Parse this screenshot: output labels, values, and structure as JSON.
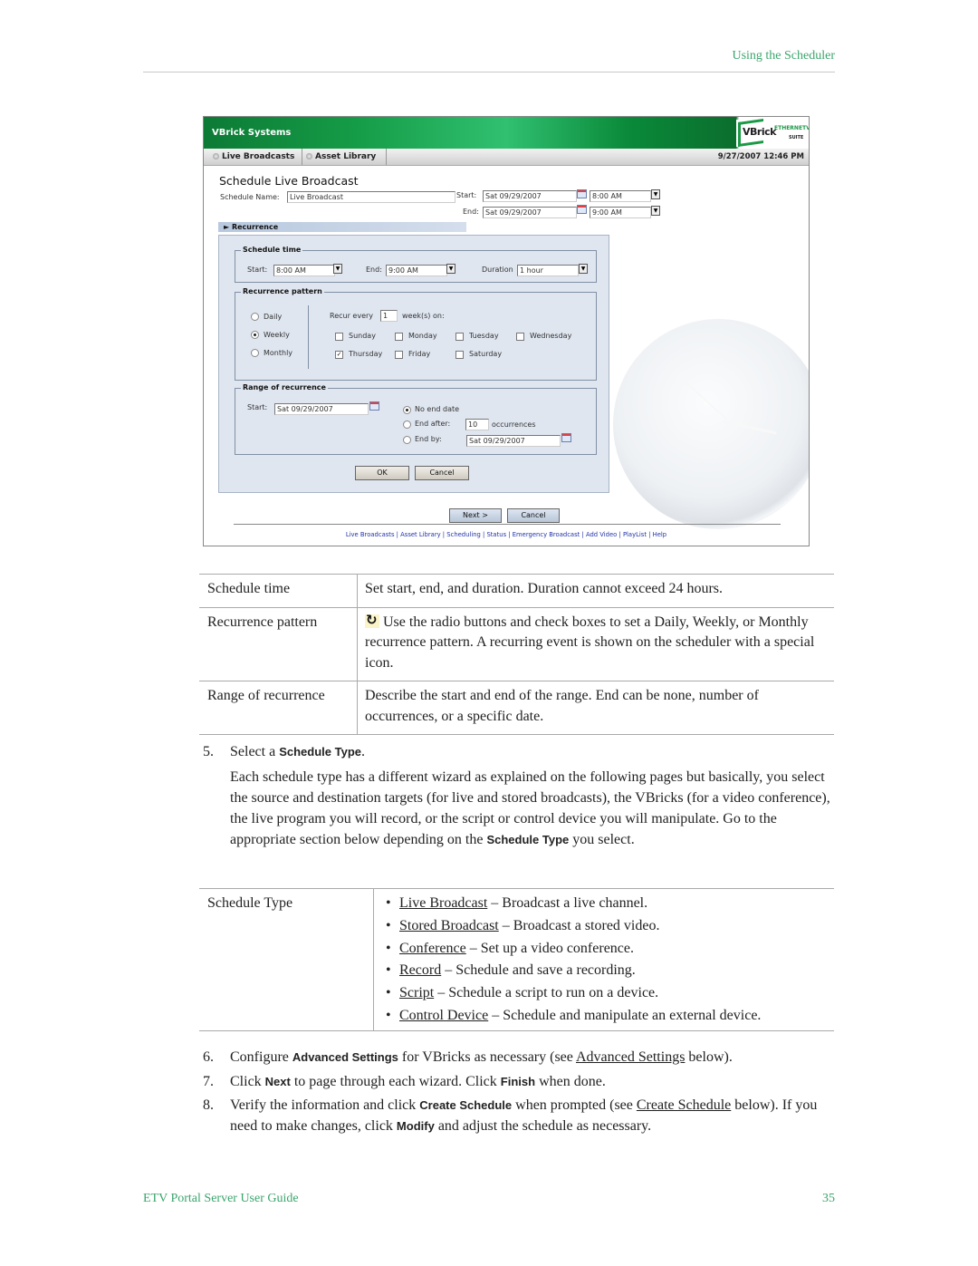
{
  "page_header": {
    "section": "Using the Scheduler"
  },
  "screenshot": {
    "brand": "VBrick Systems",
    "logo": {
      "main": "VBrick",
      "sub": "ETHERNETV",
      "suite": "SUITE"
    },
    "tabs": [
      {
        "label": "Live Broadcasts"
      },
      {
        "label": "Asset Library"
      }
    ],
    "datetime": "9/27/2007 12:46 PM",
    "form_title": "Schedule Live Broadcast",
    "schedule_name_label": "Schedule Name:",
    "schedule_name_value": "Live Broadcast",
    "start_label": "Start:",
    "start_date": "Sat 09/29/2007",
    "start_time": "8:00 AM",
    "end_label": "End:",
    "end_date": "Sat 09/29/2007",
    "end_time": "9:00 AM",
    "recurrence_toggle": "► Recurrence",
    "recurrence_dialog": {
      "schedule_time": {
        "legend": "Schedule time",
        "start_label": "Start:",
        "start_value": "8:00 AM",
        "end_label": "End:",
        "end_value": "9:00 AM",
        "duration_label": "Duration",
        "duration_value": "1 hour"
      },
      "recurrence_pattern": {
        "legend": "Recurrence pattern",
        "options": [
          {
            "label": "Daily",
            "selected": false
          },
          {
            "label": "Weekly",
            "selected": true
          },
          {
            "label": "Monthly",
            "selected": false
          }
        ],
        "recur_every_label": "Recur every",
        "recur_every_value": "1",
        "weeks_on_label": "week(s) on:",
        "days": [
          {
            "label": "Sunday",
            "checked": false
          },
          {
            "label": "Monday",
            "checked": false
          },
          {
            "label": "Tuesday",
            "checked": false
          },
          {
            "label": "Wednesday",
            "checked": false
          },
          {
            "label": "Thursday",
            "checked": true
          },
          {
            "label": "Friday",
            "checked": false
          },
          {
            "label": "Saturday",
            "checked": false
          }
        ]
      },
      "range_of_recurrence": {
        "legend": "Range of recurrence",
        "start_label": "Start:",
        "start_value": "Sat 09/29/2007",
        "no_end_label": "No end date",
        "end_after_label": "End after:",
        "end_after_value": "10",
        "occurrences_label": "occurrences",
        "end_by_label": "End by:",
        "end_by_value": "Sat 09/29/2007",
        "selected": "No end date"
      },
      "ok_label": "OK",
      "cancel_label": "Cancel"
    },
    "next_label": "Next >",
    "cancel_label": "Cancel",
    "footer_links": [
      "Live Broadcasts",
      "Asset Library",
      "Scheduling",
      "Status",
      "Emergency Broadcast",
      "Add Video",
      "PlayList",
      "Help"
    ]
  },
  "field_table": [
    {
      "field": "Schedule time",
      "description": "Set start, end, and duration. Duration cannot exceed 24 hours."
    },
    {
      "field": "Recurrence pattern",
      "description": "Use the radio buttons and check boxes to set a Daily, Weekly, or Monthly recurrence pattern. A recurring event is shown on the scheduler with a special icon.",
      "icon": "recurring-icon"
    },
    {
      "field": "Range of recurrence",
      "description": "Describe the start and end of the range. End can be none, number of occurrences, or a specific date."
    }
  ],
  "step5": {
    "number": "5.",
    "prefix": "Select a ",
    "bold": "Schedule Type",
    "suffix": ".",
    "paragraph_main": "Each schedule type has a different wizard as explained on the following pages but basically, you select the source and destination targets (for live and stored broadcasts), the VBricks (for a video conference), the live program you will record, or the script or control device you will manipulate. Go to the appropriate section below depending on the ",
    "paragraph_bold": "Schedule Type",
    "paragraph_end": " you select."
  },
  "type_table": {
    "field": "Schedule Type",
    "items": [
      {
        "link": "Live Broadcast",
        "text": " – Broadcast a live channel."
      },
      {
        "link": "Stored Broadcast",
        "text": " – Broadcast a stored video."
      },
      {
        "link": "Conference",
        "text": " – Set up a video conference."
      },
      {
        "link": "Record",
        "text": " – Schedule and save a recording."
      },
      {
        "link": "Script",
        "text": " – Schedule a script to run on a device."
      },
      {
        "link": "Control Device",
        "text": " – Schedule and manipulate an external device."
      }
    ]
  },
  "step6": {
    "number": "6.",
    "a": "Configure ",
    "b": "Advanced Settings",
    "c": " for VBricks as necessary (see ",
    "link": "Advanced Settings",
    "d": " below)."
  },
  "step7": {
    "number": "7.",
    "a": "Click ",
    "b": "Next",
    "c": " to page through each wizard. Click ",
    "d": "Finish",
    "e": " when done."
  },
  "step8": {
    "number": "8.",
    "a": "Verify the information and click ",
    "b": "Create Schedule",
    "c": " when prompted (see ",
    "link": "Create Schedule",
    "d": " below). If you need to make changes, click ",
    "e": "Modify",
    "f": " and adjust the schedule as necessary."
  },
  "page_footer": {
    "title": "ETV Portal Server User Guide",
    "page": "35"
  }
}
